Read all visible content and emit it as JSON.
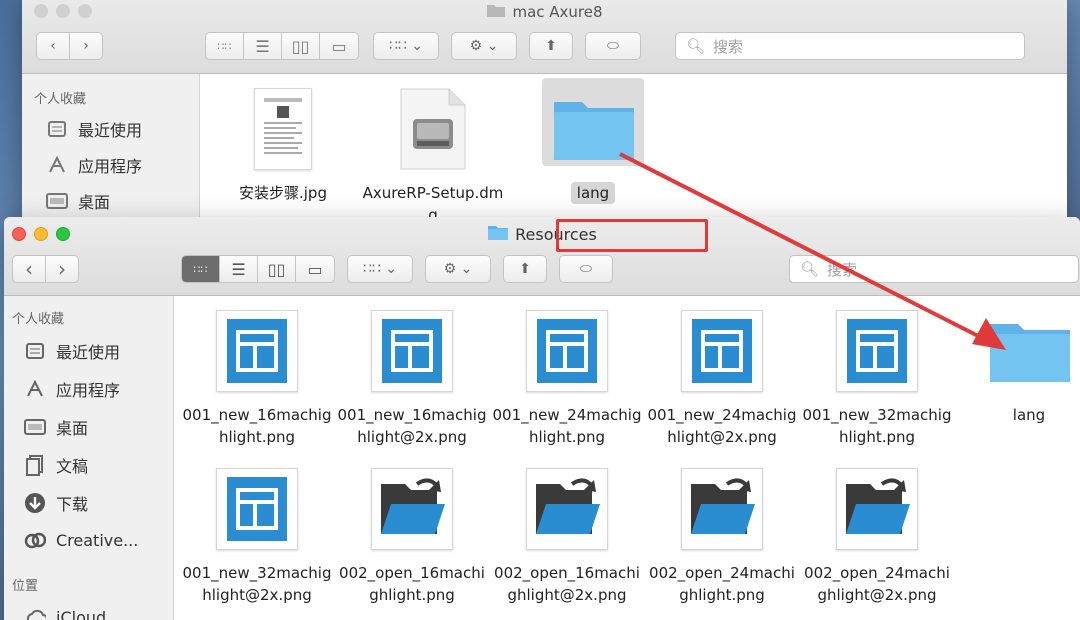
{
  "back_window": {
    "title": "mac Axure8",
    "search_placeholder": "搜索",
    "sidebar": {
      "section": "个人收藏",
      "items": [
        {
          "label": "最近使用",
          "icon": "recents-icon"
        },
        {
          "label": "应用程序",
          "icon": "applications-icon"
        },
        {
          "label": "桌面",
          "icon": "desktop-icon"
        }
      ]
    },
    "files": [
      {
        "name": "安装步骤.jpg",
        "kind": "image"
      },
      {
        "name": "AxureRP-Setup.dmg",
        "kind": "disk-image"
      },
      {
        "name": "lang",
        "kind": "folder",
        "selected": true
      }
    ]
  },
  "front_window": {
    "title": "Resources",
    "search_placeholder": "搜索",
    "sidebar": {
      "favorites_header": "个人收藏",
      "favorites": [
        {
          "label": "最近使用",
          "icon": "recents-icon"
        },
        {
          "label": "应用程序",
          "icon": "applications-icon"
        },
        {
          "label": "桌面",
          "icon": "desktop-icon"
        },
        {
          "label": "文稿",
          "icon": "documents-icon"
        },
        {
          "label": "下载",
          "icon": "downloads-icon"
        },
        {
          "label": "Creative...",
          "icon": "creative-cloud-icon"
        }
      ],
      "locations_header": "位置",
      "locations": [
        {
          "label": "iCloud...",
          "icon": "icloud-icon"
        }
      ]
    },
    "files": [
      {
        "name": "001_new_16machighlight.png",
        "kind": "new"
      },
      {
        "name": "001_new_16machighlight@2x.png",
        "kind": "new"
      },
      {
        "name": "001_new_24machighlight.png",
        "kind": "new"
      },
      {
        "name": "001_new_24machighlight@2x.png",
        "kind": "new"
      },
      {
        "name": "001_new_32machighlight.png",
        "kind": "new"
      },
      {
        "name": "lang",
        "kind": "folder"
      },
      {
        "name": "001_new_32machighlight@2x.png",
        "kind": "new"
      },
      {
        "name": "002_open_16machighlight.png",
        "kind": "open"
      },
      {
        "name": "002_open_16machighlight@2x.png",
        "kind": "open"
      },
      {
        "name": "002_open_24machighlight.png",
        "kind": "open"
      },
      {
        "name": "002_open_24machighlight@2x.png",
        "kind": "open"
      }
    ]
  },
  "colors": {
    "annotation_red": "#e03a3a",
    "folder_blue": "#6cc0ee",
    "icon_blue": "#2a8dd2"
  }
}
